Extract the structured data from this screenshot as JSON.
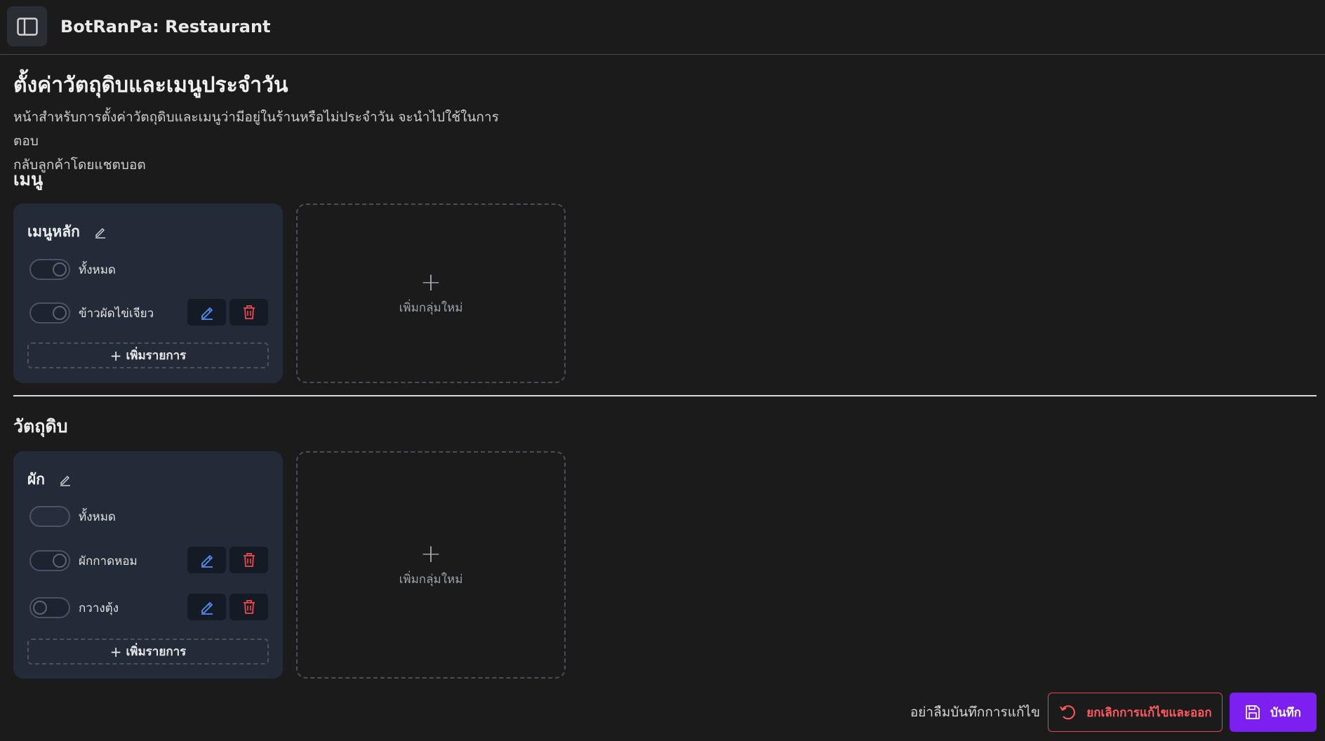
{
  "header": {
    "app_title": "BotRanPa: Restaurant",
    "toggle_icon": "sidebar-panel-icon"
  },
  "page": {
    "title": "ตั้งค่าวัตถุดิบและเมนูประจำวัน",
    "description_line1": "หน้าสำหรับการตั้งค่าวัตถุดิบและเมนูว่ามีอยู่ในร้านหรือไม่ประจำวัน จะนำไปใช้ในการตอบ",
    "description_line2": "กลับลูกค้าโดยแชตบอต"
  },
  "menu_section": {
    "title": "เมนู",
    "group": {
      "name": "เมนูหลัก",
      "all_label": "ทั้งหมด",
      "all_state": "on",
      "items": [
        {
          "label": "ข้าวผัดไข่เจียว",
          "state": "on"
        }
      ],
      "add_item_label": "เพิ่มรายการ"
    },
    "add_group_label": "เพิ่มกลุ่มใหม่"
  },
  "ingredient_section": {
    "title": "วัตถุดิบ",
    "group": {
      "name": "ผัก",
      "all_label": "ทั้งหมด",
      "all_state": "mixed",
      "items": [
        {
          "label": "ผักกาดหอม",
          "state": "on"
        },
        {
          "label": "กวางตุ้ง",
          "state": "off"
        }
      ],
      "add_item_label": "เพิ่มรายการ"
    },
    "add_group_label": "เพิ่มกลุ่มใหม่"
  },
  "footer": {
    "reminder": "อย่าลืมบันทึกการแก้ไข",
    "cancel_label": "ยกเลิกการแก้ไขและออก",
    "save_label": "บันทึก"
  },
  "colors": {
    "accent": "#7c1ff0",
    "danger": "#ff5a5f",
    "edit_icon": "#4f8df5"
  }
}
